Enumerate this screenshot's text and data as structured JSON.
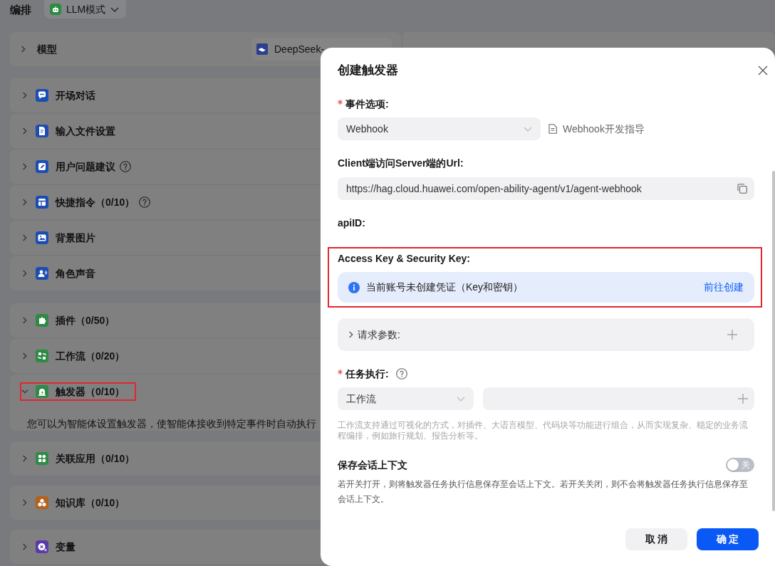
{
  "page": {
    "title": "编排",
    "mode": {
      "label": "LLM模式"
    }
  },
  "model": {
    "label": "模型",
    "expanded": false,
    "value": "DeepSeek-"
  },
  "sections": [
    {
      "items": [
        {
          "label": "开场对话",
          "color": "#1c4db3",
          "help": false,
          "expanded": false,
          "highlighted": false
        },
        {
          "label": "输入文件设置",
          "color": "#1c4db3",
          "help": false,
          "expanded": false,
          "highlighted": false
        },
        {
          "label": "用户问题建议",
          "color": "#1c4db3",
          "help": true,
          "expanded": false,
          "highlighted": false
        },
        {
          "label": "快捷指令（0/10）",
          "color": "#1c4db3",
          "help": true,
          "expanded": false,
          "highlighted": false
        },
        {
          "label": "背景图片",
          "color": "#1c4db3",
          "help": false,
          "expanded": false,
          "highlighted": false
        },
        {
          "label": "角色声音",
          "color": "#1c4db3",
          "help": false,
          "expanded": false,
          "highlighted": false
        }
      ]
    },
    {
      "items": [
        {
          "label": "插件（0/50）",
          "color": "#2e8a45",
          "help": false,
          "expanded": false,
          "highlighted": false
        },
        {
          "label": "工作流（0/20）",
          "color": "#2e8a45",
          "help": false,
          "expanded": false,
          "highlighted": false
        },
        {
          "label": "触发器（0/10）",
          "color": "#2e8a45",
          "help": false,
          "expanded": true,
          "highlighted": true,
          "description": "您可以为智能体设置触发器，使智能体接收到特定事件时自动执行"
        },
        {
          "label": "关联应用（0/10）",
          "color": "#2e8a45",
          "help": false,
          "expanded": false,
          "highlighted": false
        }
      ]
    },
    {
      "items": [
        {
          "label": "知识库（0/10）",
          "color": "#b3621e",
          "help": false,
          "expanded": false,
          "highlighted": false
        }
      ]
    },
    {
      "items": [
        {
          "label": "变量",
          "color": "#5a3aa8",
          "help": false,
          "expanded": false,
          "highlighted": false
        }
      ]
    }
  ],
  "dialog": {
    "title": "创建触发器",
    "event": {
      "label": "事件选项:",
      "required": true,
      "value": "Webhook",
      "guide": "Webhook开发指导"
    },
    "url": {
      "label": "Client端访问Server端的Url:",
      "value": "https://hag.cloud.huawei.com/open-ability-agent/v1/agent-webhook"
    },
    "api_id": {
      "label": "apiID:"
    },
    "credentials": {
      "label": "Access Key & Security Key:",
      "highlighted": true,
      "notice": "当前账号未创建凭证（Key和密钥）",
      "action": "前往创建"
    },
    "request_params": {
      "label": "请求参数:",
      "expanded": false
    },
    "task": {
      "label": "任务执行:",
      "required": true,
      "help": true,
      "type": "工作流",
      "hint": "工作流支持通过可视化的方式，对插件、大语言模型、代码块等功能进行组合，从而实现复杂、稳定的业务流程编排，例如旅行规划、报告分析等。"
    },
    "save_context": {
      "label": "保存会话上下文",
      "on": false,
      "toggle_text": "关",
      "description": "若开关打开，则将触发器任务执行信息保存至会话上下文。若开关关闭，则不会将触发器任务执行信息保存至会话上下文。"
    },
    "buttons": [
      {
        "label": "取 消",
        "kind": "secondary"
      },
      {
        "label": "确 定",
        "kind": "primary"
      }
    ]
  }
}
